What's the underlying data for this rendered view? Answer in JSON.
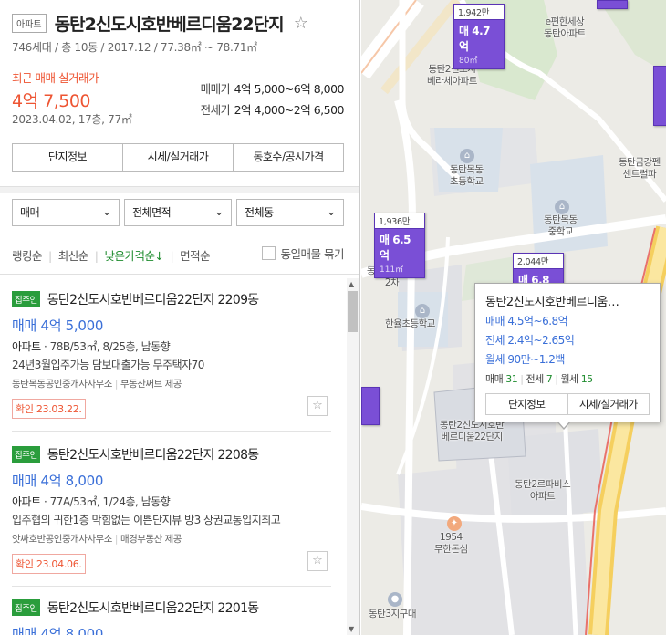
{
  "complex": {
    "type_badge": "아파트",
    "name": "동탄2신도시호반베르디움22단지",
    "star": "☆",
    "summary": "746세대 / 총 10동 / 2017.12 / 77.38㎡ ~ 78.71㎡"
  },
  "recent": {
    "label": "최근 매매 실거래가",
    "price": "4억 7,500",
    "date": "2023.04.02, 17층, 77㎡"
  },
  "ranges": {
    "sale_label": "매매가",
    "sale_value": "4억 5,000~6억 8,000",
    "jeonse_label": "전세가",
    "jeonse_value": "2억 4,000~2억 6,500"
  },
  "tabs": [
    "단지정보",
    "시세/실거래가",
    "동호수/공시가격"
  ],
  "filters": {
    "deal": "매매",
    "area": "전체면적",
    "dong": "전체동"
  },
  "sort": {
    "options": [
      "랭킹순",
      "최신순",
      "낮은가격순↓",
      "면적순"
    ],
    "same_label": "동일매물 묶기"
  },
  "listings": [
    {
      "badge": "집주인",
      "title": "동탄2신도시호반베르디움22단지 2209동",
      "price": "매매 4억 5,000",
      "type": "아파트",
      "detail": "· 78B/53㎡, 8/25층, 남동향",
      "memo": "24년3월입주가능 담보대출가능 무주택자70",
      "agent": "동탄목동공인중개사사무소",
      "provider": "부동산써브 제공",
      "confirm": "확인 23.03.22."
    },
    {
      "badge": "집주인",
      "title": "동탄2신도시호반베르디움22단지 2208동",
      "price": "매매 4억 8,000",
      "type": "아파트",
      "detail": "· 77A/53㎡, 1/24층, 남동향",
      "memo": "입주협의 귀한1층 막힘없는 이쁜단지뷰 방3 상권교통입지최고",
      "agent": "앗싸호반공인중개사사무소",
      "provider": "매경부동산 제공",
      "confirm": "확인 23.04.06."
    },
    {
      "badge": "집주인",
      "title": "동탄2신도시호반베르디움22단지 2201동",
      "price": "매매 4억 8,000"
    }
  ],
  "map": {
    "markers": [
      {
        "top": "1,942만",
        "main": "매 4.7억",
        "area": "80㎡"
      },
      {
        "top": "1,936만",
        "main": "매 6.5억",
        "area": "111㎡"
      },
      {
        "top": "2,044만",
        "main": "매 6.8억",
        "area": ""
      }
    ],
    "places": [
      "e편한세상\n동탄아파트",
      "동탄2신도시\n베라체아파트",
      "동탄목동\n초등학교",
      "동탄목동\n중학교",
      "동탄금강펜\n센트럴파",
      "동탄로얄튜크\n2차",
      "한율초등학교",
      "동탄2신도시호반\n베르디움22단지",
      "동탄2르파비스\n아파트",
      "1954\n무한돈심",
      "동탄3지구대"
    ],
    "popup": {
      "title": "동탄2신도시호반베르디움…",
      "sale": "매매 4.5억~6.8억",
      "jeonse": "전세 2.4억~2.65억",
      "monthly": "월세 90만~1.2백",
      "count_sale_label": "매매",
      "count_sale": "31",
      "count_jeonse_label": "전세",
      "count_jeonse": "7",
      "count_monthly_label": "월세",
      "count_monthly": "15",
      "btn_info": "단지정보",
      "btn_price": "시세/실거래가"
    }
  },
  "colors": {
    "accent_red": "#ee5533",
    "price_blue": "#3a6fd8",
    "marker_purple": "#7a4fd6",
    "badge_green": "#2a9d3c"
  }
}
